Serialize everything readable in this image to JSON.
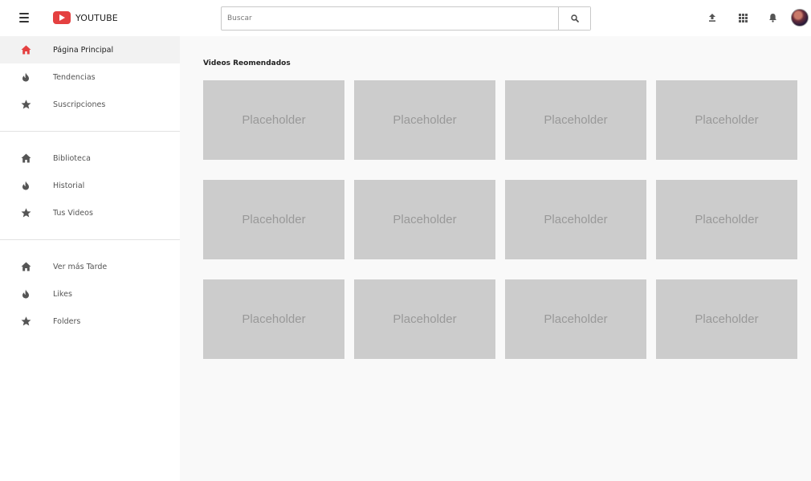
{
  "app": {
    "logo_text": "YOUTUBE",
    "brand_color": "#e44040"
  },
  "header": {
    "search": {
      "placeholder": "Buscar",
      "value": ""
    },
    "icons": [
      "upload-icon",
      "apps-grid-icon",
      "bell-icon",
      "avatar"
    ]
  },
  "sidebar": {
    "groups": [
      [
        {
          "label": "Página Principal",
          "icon": "home-icon",
          "active": true
        },
        {
          "label": "Tendencias",
          "icon": "flame-icon"
        },
        {
          "label": "Suscripciones",
          "icon": "star-icon"
        }
      ],
      [
        {
          "label": "Biblioteca",
          "icon": "home-icon"
        },
        {
          "label": "Historial",
          "icon": "flame-icon"
        },
        {
          "label": "Tus Videos",
          "icon": "star-icon"
        }
      ],
      [
        {
          "label": "Ver más Tarde",
          "icon": "home-icon"
        },
        {
          "label": "Likes",
          "icon": "flame-icon"
        },
        {
          "label": "Folders",
          "icon": "star-icon"
        }
      ]
    ]
  },
  "main": {
    "section_title": "Videos Reomendados",
    "thumbnails": [
      "Placeholder",
      "Placeholder",
      "Placeholder",
      "Placeholder",
      "Placeholder",
      "Placeholder",
      "Placeholder",
      "Placeholder",
      "Placeholder",
      "Placeholder",
      "Placeholder",
      "Placeholder"
    ]
  }
}
